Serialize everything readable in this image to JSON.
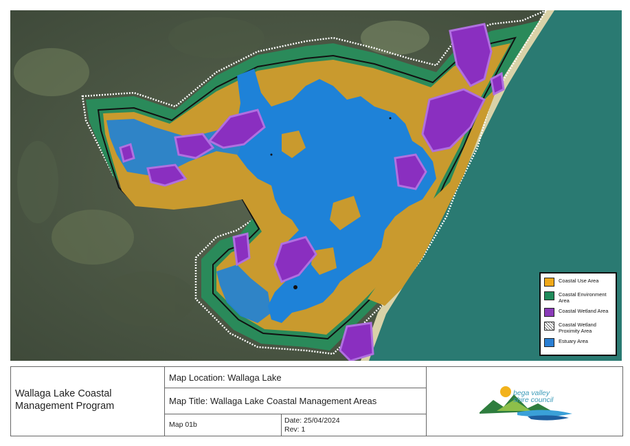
{
  "map": {
    "colors": {
      "coastal_use": "#c99a2e",
      "coastal_environment": "#2a8a5a",
      "coastal_wetland": "#8a2fc0",
      "estuary": "#1e82d8",
      "ocean": "#2a7a72"
    }
  },
  "legend": {
    "items": [
      {
        "label": "Coastal Use Area",
        "color": "#f0a818"
      },
      {
        "label": "Coastal Environment Area",
        "color": "#1f8a5a"
      },
      {
        "label": "Coastal Wetland Area",
        "color": "#8a3ab8"
      },
      {
        "label": "Coastal Wetland Proximity Area",
        "color": "hatch"
      },
      {
        "label": "Estuary Area",
        "color": "#2a7fd4"
      }
    ]
  },
  "title_block": {
    "program": "Wallaga Lake Coastal Management Program",
    "location": "Map Location: Wallaga Lake",
    "map_title": "Map Title: Wallaga Lake Coastal Management Areas",
    "map_number": "Map 01b",
    "date": "Date: 25/04/2024",
    "rev": "Rev: 1"
  },
  "logo": {
    "line1": "bega valley",
    "line2": "shire council"
  }
}
